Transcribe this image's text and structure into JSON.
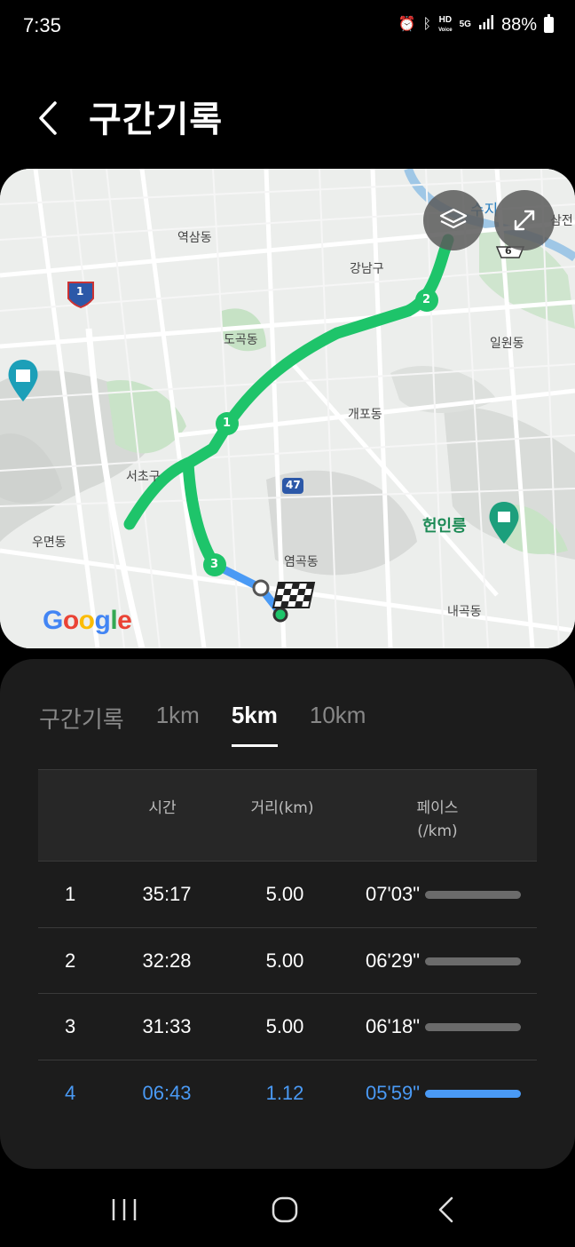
{
  "status": {
    "time": "7:35",
    "hd": "HD",
    "voice": "Voice",
    "network": "5G",
    "battery": "88%",
    "icons": [
      "alarm-icon",
      "bluetooth-icon",
      "hd-voice-icon",
      "5g-icon",
      "signal-icon",
      "battery-icon"
    ]
  },
  "header": {
    "title": "구간기록",
    "back_icon": "chevron-left-icon"
  },
  "map": {
    "labels": {
      "yeoksam": "역삼동",
      "gangnam": "강남구",
      "dogok": "도곡동",
      "ilwon": "일원동",
      "gaepo": "개포동",
      "seocho": "서초구",
      "umyeon": "우면동",
      "heonilleung": "헌인릉",
      "yeomgok": "염곡동",
      "naegok": "내곡동",
      "samjeon": "삼전",
      "river": "수지"
    },
    "route_badge_1": "1",
    "route_badge_47": "47",
    "route_badge_right": "6",
    "markers": [
      "1",
      "2",
      "3"
    ],
    "google_logo": [
      "G",
      "o",
      "o",
      "g",
      "l",
      "e"
    ],
    "layers_icon": "layers-icon",
    "expand_icon": "expand-icon",
    "route_color": "#1db954",
    "current_segment_color": "#4a9af5"
  },
  "tabs": [
    {
      "label": "구간기록",
      "active": false
    },
    {
      "label": "1km",
      "active": false
    },
    {
      "label": "5km",
      "active": true
    },
    {
      "label": "10km",
      "active": false
    }
  ],
  "table": {
    "headers": {
      "time": "시간",
      "distance": "거리(km)",
      "pace_line1": "페이스",
      "pace_line2": "(/km)"
    },
    "rows": [
      {
        "index": "1",
        "time": "35:17",
        "distance": "5.00",
        "pace": "07'03\"",
        "pace_fraction": 1.0,
        "current": false
      },
      {
        "index": "2",
        "time": "32:28",
        "distance": "5.00",
        "pace": "06'29\"",
        "pace_fraction": 1.0,
        "current": false
      },
      {
        "index": "3",
        "time": "31:33",
        "distance": "5.00",
        "pace": "06'18\"",
        "pace_fraction": 1.0,
        "current": false
      },
      {
        "index": "4",
        "time": "06:43",
        "distance": "1.12",
        "pace": "05'59\"",
        "pace_fraction": 1.0,
        "current": true
      }
    ]
  },
  "nav": {
    "recents_icon": "recents-icon",
    "home_icon": "home-icon",
    "back_icon": "back-icon"
  }
}
